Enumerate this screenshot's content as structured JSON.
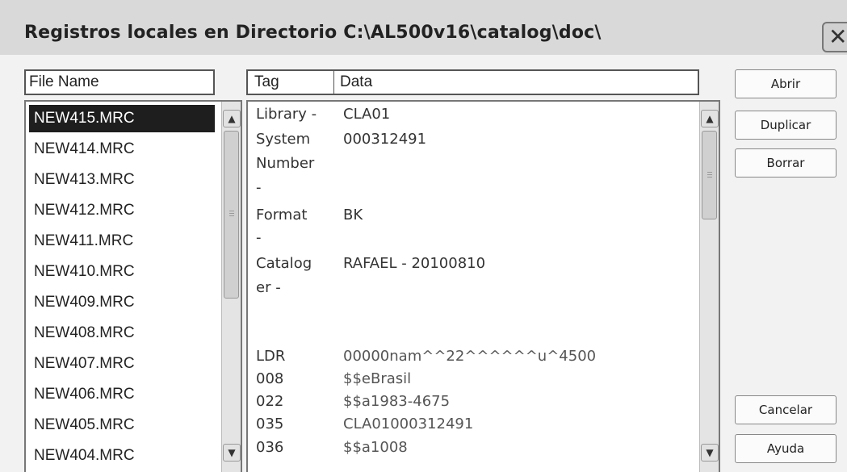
{
  "window": {
    "title": "Registros locales en Directorio C:\\AL500v16\\catalog\\doc\\"
  },
  "icons": {
    "close": "close-icon",
    "scroll_up": "chevron-up-icon",
    "scroll_down": "chevron-down-icon"
  },
  "file_list": {
    "header": "File Name",
    "items": [
      "NEW415.MRC",
      "NEW414.MRC",
      "NEW413.MRC",
      "NEW412.MRC",
      "NEW411.MRC",
      "NEW410.MRC",
      "NEW409.MRC",
      "NEW408.MRC",
      "NEW407.MRC",
      "NEW406.MRC",
      "NEW405.MRC",
      "NEW404.MRC"
    ],
    "selected": "NEW415.MRC"
  },
  "record": {
    "col_tag": "Tag",
    "col_data": "Data",
    "header_tags": [
      "Library -",
      "System",
      "Number",
      "-",
      "Format",
      "-",
      "Catalog",
      "er -"
    ],
    "header_values": {
      "library": "CLA01",
      "system_number": "000312491",
      "format": "BK",
      "cataloger": "RAFAEL - 20100810"
    },
    "fields": [
      {
        "tag": "LDR",
        "data": "00000nam^^22^^^^^^u^4500"
      },
      {
        "tag": "008",
        "data": "$$eBrasil"
      },
      {
        "tag": "022",
        "data": "$$a1983-4675"
      },
      {
        "tag": "035",
        "data": "CLA01000312491"
      },
      {
        "tag": "036",
        "data": "$$a1008"
      }
    ]
  },
  "buttons": {
    "open": "Abrir",
    "duplicate": "Duplicar",
    "delete": "Borrar",
    "cancel": "Cancelar",
    "help": "Ayuda"
  }
}
